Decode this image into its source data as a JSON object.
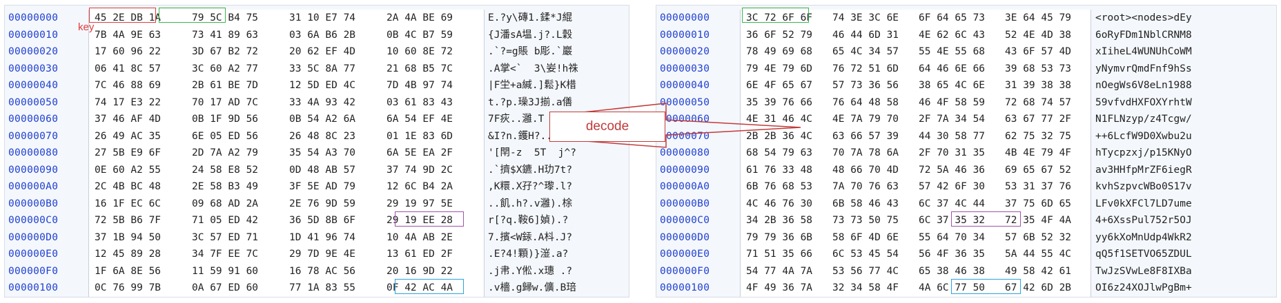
{
  "offsets": [
    "00000000",
    "00000010",
    "00000020",
    "00000030",
    "00000040",
    "00000050",
    "00000060",
    "00000070",
    "00000080",
    "00000090",
    "000000A0",
    "000000B0",
    "000000C0",
    "000000D0",
    "000000E0",
    "000000F0",
    "00000100"
  ],
  "left": {
    "hex": [
      [
        "45 2E DB 1A",
        "79 5C B4 75",
        "31 10 E7 74",
        "2A 4A BE 69"
      ],
      [
        "7B 4A 9E 63",
        "73 41 89 63",
        "03 6A B6 2B",
        "0B 4C B7 59"
      ],
      [
        "17 60 96 22",
        "3D 67 B2 72",
        "20 62 EF 4D",
        "10 60 8E 72"
      ],
      [
        "06 41 8C 57",
        "3C 60 A2 77",
        "33 5C 8A 77",
        "21 68 B5 7C"
      ],
      [
        "7C 46 88 69",
        "2B 61 BE 7D",
        "12 5D ED 4C",
        "7D 4B 97 74"
      ],
      [
        "74 17 E3 22",
        "70 17 AD 7C",
        "33 4A 93 42",
        "03 61 83 43"
      ],
      [
        "37 46 AF 4D",
        "0B 1F 9D 56",
        "0B 54 A2 6A",
        "6A 54 EF 4E"
      ],
      [
        "26 49 AC 35",
        "6E 05 ED 56",
        "26 48 8C 23",
        "01 1E 83 6D"
      ],
      [
        "27 5B E9 6F",
        "2D 7A A2 79",
        "35 54 A3 70",
        "6A 5E EA 2F"
      ],
      [
        "0E 60 A2 55",
        "24 58 E8 52",
        "0D 48 AB 57",
        "37 74 9D 2C"
      ],
      [
        "2C 4B BC 48",
        "2E 58 B3 49",
        "3F 5E AD 79",
        "12 6C B4 2A"
      ],
      [
        "16 1F EC 6C",
        "09 68 AD 2A",
        "2E 76 9D 59",
        "29 19 97 5E"
      ],
      [
        "72 5B B6 7F",
        "71 05 ED 42",
        "36 5D 8B 6F",
        "29 19 EE 28"
      ],
      [
        "37 1B 94 50",
        "3C 57 ED 71",
        "1D 41 96 74",
        "10 4A AB 2E"
      ],
      [
        "12 45 89 28",
        "34 7F EE 7C",
        "29 7D 9E 4E",
        "13 61 ED 2F"
      ],
      [
        "1F 6A 8E 56",
        "11 59 91 60",
        "16 78 AC 56",
        "20 16 9D 22"
      ],
      [
        "0C 76 99 7B",
        "0A 67 ED 60",
        "77 1A 83 55",
        "0F 42 AC 4A"
      ]
    ],
    "ascii": [
      "E.?y\\磚1.鍒*J緄",
      "{J潘sA塭.j?.L穀",
      ".`?=g賬 b彫.`巖",
      ".A掌<`  3\\妛!h祩",
      "|F坣+a緘.]鬆}K棤",
      "t.?p.璪3J揃.a僐",
      "7F疢..灉.T  j1嵐",
      "&I?n.鑊H?..僴",
      "'[閈-z  5T  j^?",
      ".`擠$X鑣.H玏7t?",
      ",K糫.X孖?^瓈.l?",
      "..飢.h?.v灉).梌",
      "r[?q.鞍6]媜).?",
      "7.擯<W銾.A枓.J?",
      ".E?4!顆)}潂.a?",
      ".j帇.Y倯.x璤 .?",
      ".v檣.g歸w.儣.B琣"
    ]
  },
  "right": {
    "hex": [
      [
        "3C 72 6F 6F",
        "74 3E 3C 6E",
        "6F 64 65 73",
        "3E 64 45 79"
      ],
      [
        "36 6F 52 79",
        "46 44 6D 31",
        "4E 62 6C 43",
        "52 4E 4D 38"
      ],
      [
        "78 49 69 68",
        "65 4C 34 57",
        "55 4E 55 68",
        "43 6F 57 4D"
      ],
      [
        "79 4E 79 6D",
        "76 72 51 6D",
        "64 46 6E 66",
        "39 68 53 73"
      ],
      [
        "6E 4F 65 67",
        "57 73 36 56",
        "38 65 4C 6E",
        "31 39 38 38"
      ],
      [
        "35 39 76 66",
        "76 64 48 58",
        "46 4F 58 59",
        "72 68 74 57"
      ],
      [
        "4E 31 46 4C",
        "4E 7A 79 70",
        "2F 7A 34 54",
        "63 67 77 2F"
      ],
      [
        "2B 2B 36 4C",
        "63 66 57 39",
        "44 30 58 77",
        "62 75 32 75"
      ],
      [
        "68 54 79 63",
        "70 7A 78 6A",
        "2F 70 31 35",
        "4B 4E 79 4F"
      ],
      [
        "61 76 33 48",
        "48 66 70 4D",
        "72 5A 46 36",
        "69 65 67 52"
      ],
      [
        "6B 76 68 53",
        "7A 70 76 63",
        "57 42 6F 30",
        "53 31 37 76"
      ],
      [
        "4C 46 76 30",
        "6B 58 46 43",
        "6C 37 4C 44",
        "37 75 6D 65"
      ],
      [
        "34 2B 36 58",
        "73 73 50 75",
        "6C 37 35 32",
        "72 35 4F 4A"
      ],
      [
        "79 79 36 6B",
        "58 6F 4D 6E",
        "55 64 70 34",
        "57 6B 52 32"
      ],
      [
        "71 51 35 66",
        "6C 53 45 54",
        "56 4F 36 35",
        "5A 44 55 4C"
      ],
      [
        "54 77 4A 7A",
        "53 56 77 4C",
        "65 38 46 38",
        "49 58 42 61"
      ],
      [
        "4F 49 36 7A",
        "32 34 58 4F",
        "4A 6C 77 50",
        "67 42 6D 2B"
      ]
    ],
    "ascii": [
      "<root><nodes>dEy",
      "6oRyFDm1NblCRNM8",
      "xIiheL4WUNUhCoWM",
      "yNymvrQmdFnf9hSs",
      "nOegWs6V8eLn1988",
      "59vfvdHXFOXYrhtW",
      "N1FLNzyp/z4Tcgw/",
      "++6LcfW9D0Xwbu2u",
      "hTycpzxj/p15KNyO",
      "av3HHfpMrZF6iegR",
      "kvhSzpvcWBo0S17v",
      "LFv0kXFCl7LD7ume",
      "4+6XssPul752r5OJ",
      "yy6kXoMnUdp4WkR2",
      "qQ5f1SETVO65ZDUL",
      "TwJzSVwLe8F8IXBa",
      "OI6z24XOJlwPgBm+"
    ]
  },
  "labels": {
    "key": "key",
    "decode": "decode"
  },
  "colors": {
    "red": "#e03c3c",
    "green": "#3ab54a",
    "purple": "#a052a8",
    "blue": "#2aa4dc",
    "offset": "#1f3fd1"
  }
}
